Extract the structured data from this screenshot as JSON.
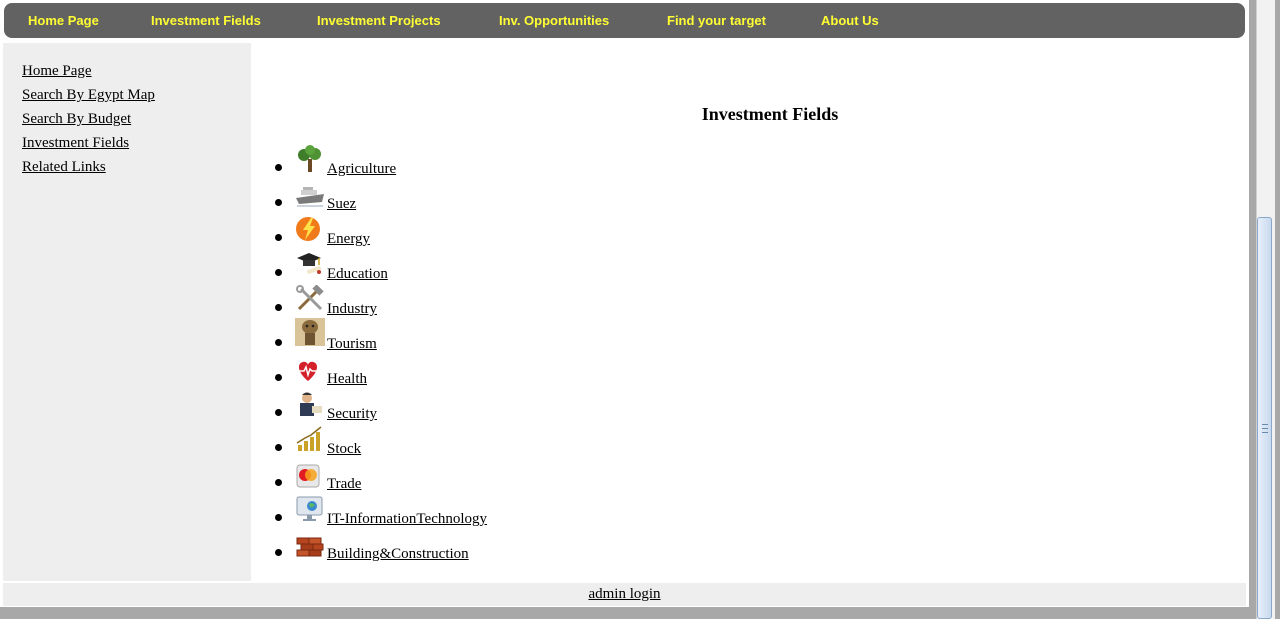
{
  "nav": {
    "items": [
      {
        "label": "Home Page"
      },
      {
        "label": "Investment Fields"
      },
      {
        "label": "Investment Projects"
      },
      {
        "label": "Inv. Opportunities"
      },
      {
        "label": "Find your target"
      },
      {
        "label": "About Us"
      }
    ]
  },
  "sidebar": {
    "links": [
      {
        "label": "Home Page"
      },
      {
        "label": "Search By Egypt Map"
      },
      {
        "label": "Search By Budget"
      },
      {
        "label": "Investment Fields"
      },
      {
        "label": "Related Links"
      }
    ]
  },
  "main": {
    "title": "Investment Fields",
    "fields": [
      {
        "label": " Agriculture",
        "icon": "tree-icon"
      },
      {
        "label": " Suez",
        "icon": "ship-icon"
      },
      {
        "label": " Energy",
        "icon": "lightning-icon"
      },
      {
        "label": " Education",
        "icon": "graduation-cap-icon"
      },
      {
        "label": " Industry",
        "icon": "tools-icon"
      },
      {
        "label": " Tourism",
        "icon": "pharaoh-icon"
      },
      {
        "label": " Health",
        "icon": "heart-pulse-icon"
      },
      {
        "label": " Security",
        "icon": "officer-icon"
      },
      {
        "label": " Stock",
        "icon": "rising-chart-icon"
      },
      {
        "label": " Trade",
        "icon": "credit-card-icon"
      },
      {
        "label": " IT-InformationTechnology",
        "icon": "computer-monitor-icon"
      },
      {
        "label": " Building&Construction",
        "icon": "bricks-icon"
      }
    ]
  },
  "footer": {
    "admin_label": "admin login"
  },
  "colors": {
    "nav_bg": "#626262",
    "nav_text": "#ffff33",
    "sidebar_bg": "#eeeeee"
  }
}
